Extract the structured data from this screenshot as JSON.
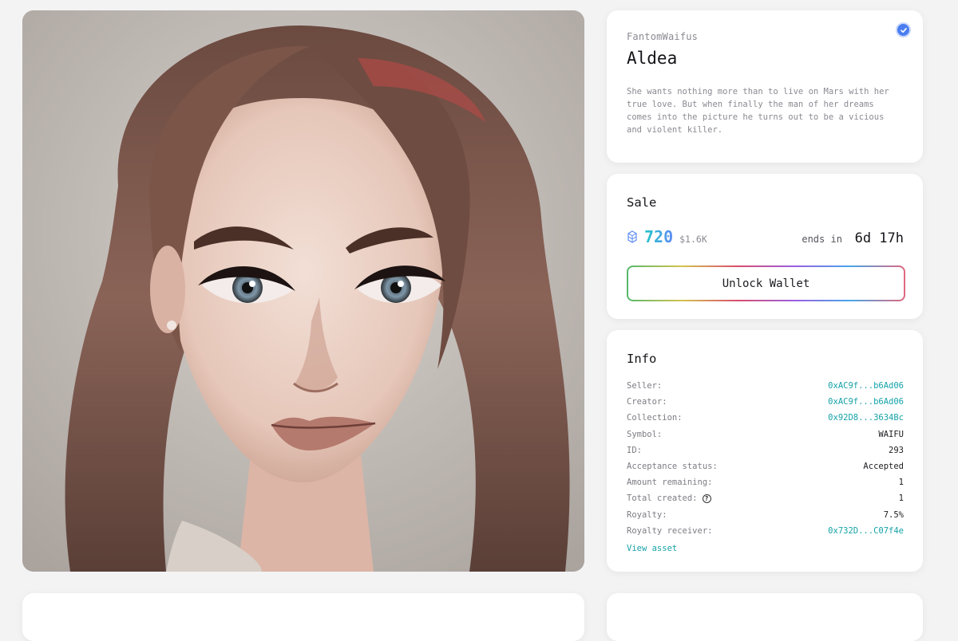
{
  "artwork": {
    "alt": "Aldea artwork"
  },
  "nft": {
    "collection": "FantomWaifus",
    "title": "Aldea",
    "description": "She wants nothing more than to live on Mars with her true love. But when finally the man of her dreams comes into the picture he turns out to be a vicious and violent killer.",
    "verified_icon": "check-badge-icon"
  },
  "sale": {
    "heading": "Sale",
    "token_icon": "fantom-token-icon",
    "price": "720",
    "price_usd": "$1.6K",
    "ends_label": "ends in",
    "ends_value": "6d 17h",
    "button_label": "Unlock Wallet"
  },
  "info": {
    "heading": "Info",
    "rows": [
      {
        "label": "Seller:",
        "value": "0xAC9f...b6Ad06",
        "link": true
      },
      {
        "label": "Creator:",
        "value": "0xAC9f...b6Ad06",
        "link": true
      },
      {
        "label": "Collection:",
        "value": "0x92D8...3634Bc",
        "link": true
      },
      {
        "label": "Symbol:",
        "value": "WAIFU",
        "link": false
      },
      {
        "label": "ID:",
        "value": "293",
        "link": false
      },
      {
        "label": "Acceptance status:",
        "value": "Accepted",
        "link": false
      },
      {
        "label": "Amount remaining:",
        "value": "1",
        "link": false
      },
      {
        "label": "Total created:",
        "value": "1",
        "link": false,
        "help": true
      },
      {
        "label": "Royalty:",
        "value": "7.5%",
        "link": false
      },
      {
        "label": "Royalty receiver:",
        "value": "0x732D...C07f4e",
        "link": true
      }
    ],
    "view_asset": "View asset"
  },
  "colors": {
    "accent_teal": "#16a3a8",
    "verified_blue": "#4a7ef0"
  }
}
